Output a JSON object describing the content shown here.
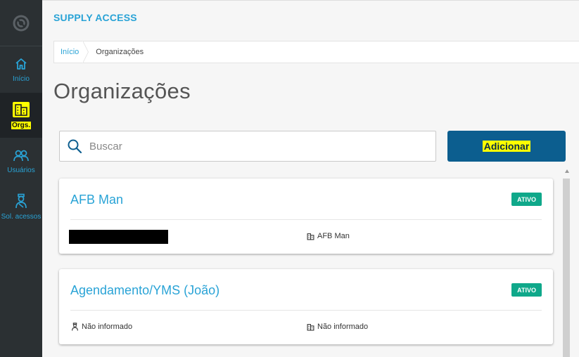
{
  "colors": {
    "accent": "#29a3d6",
    "sidebar": "#2b3033",
    "primary_button": "#0c5e8f",
    "badge": "#0fa88a",
    "highlight": "#ffff00"
  },
  "sidebar": {
    "items": [
      {
        "label": "Início",
        "icon": "home-icon"
      },
      {
        "label": "Orgs.",
        "icon": "building-icon",
        "active": true
      },
      {
        "label": "Usuários",
        "icon": "users-icon"
      },
      {
        "label": "Sol. acessos",
        "icon": "user-access-icon"
      }
    ]
  },
  "header": {
    "app_title": "SUPPLY ACCESS"
  },
  "breadcrumb": {
    "home": "Início",
    "current": "Organizações"
  },
  "page": {
    "title": "Organizações"
  },
  "search": {
    "placeholder": "Buscar",
    "value": ""
  },
  "actions": {
    "add_label": "Adicionar"
  },
  "organizations": [
    {
      "name": "AFB Man",
      "status": "ATIVO",
      "left_field": "",
      "left_redacted": true,
      "right_field": "AFB Man"
    },
    {
      "name": "Agendamento/YMS (João)",
      "status": "ATIVO",
      "left_field": "Não informado",
      "left_redacted": false,
      "right_field": "Não informado"
    }
  ]
}
